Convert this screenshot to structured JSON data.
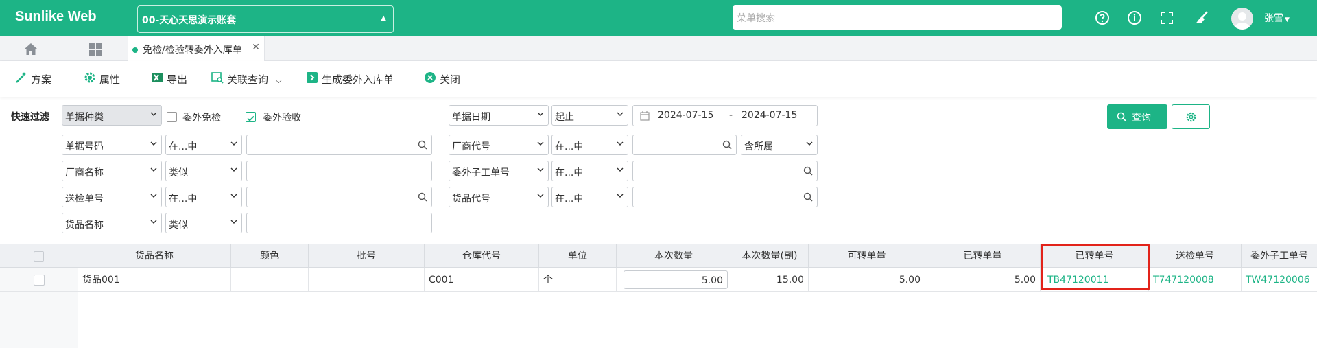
{
  "app": {
    "brand": "Sunlike Web",
    "account": "00-天心天思演示账套",
    "search_placeholder": "菜单搜索",
    "user": "张雪"
  },
  "tabs": {
    "active_label": "免检/检验转委外入库单"
  },
  "toolbar": {
    "plan": "方案",
    "props": "属性",
    "export": "导出",
    "related": "关联查询",
    "generate": "生成委外入库单",
    "close": "关闭"
  },
  "filter": {
    "title": "快速过滤",
    "doc_type": "单据种类",
    "chk_exempt": "委外免检",
    "chk_accept": "委外验收",
    "doc_date": "单据日期",
    "date_mode": "起止",
    "date_from": "2024-07-15",
    "date_sep": "-",
    "date_to": "2024-07-15",
    "query": "查询",
    "rows_left": [
      {
        "field": "单据号码",
        "op": "在...中"
      },
      {
        "field": "厂商名称",
        "op": "类似"
      },
      {
        "field": "送检单号",
        "op": "在...中"
      },
      {
        "field": "货品名称",
        "op": "类似"
      }
    ],
    "rows_right": [
      {
        "field": "厂商代号",
        "op": "在...中",
        "extra": "含所属"
      },
      {
        "field": "委外子工单号",
        "op": "在...中"
      },
      {
        "field": "货品代号",
        "op": "在...中"
      }
    ]
  },
  "grid": {
    "columns": [
      "货品名称",
      "颜色",
      "批号",
      "仓库代号",
      "单位",
      "本次数量",
      "本次数量(副)",
      "可转单量",
      "已转单量",
      "已转单号",
      "送检单号",
      "委外子工单号"
    ],
    "rows": [
      {
        "name": "货品001",
        "color": "",
        "batch": "",
        "wh": "C001",
        "unit": "个",
        "qty": "5.00",
        "qty2": "15.00",
        "avail": "5.00",
        "done": "5.00",
        "done_no": "TB47120011",
        "insp_no": "T747120008",
        "sub_no": "TW47120006"
      }
    ]
  },
  "colors": {
    "brand": "#1db486",
    "highlight": "#e2231a"
  }
}
